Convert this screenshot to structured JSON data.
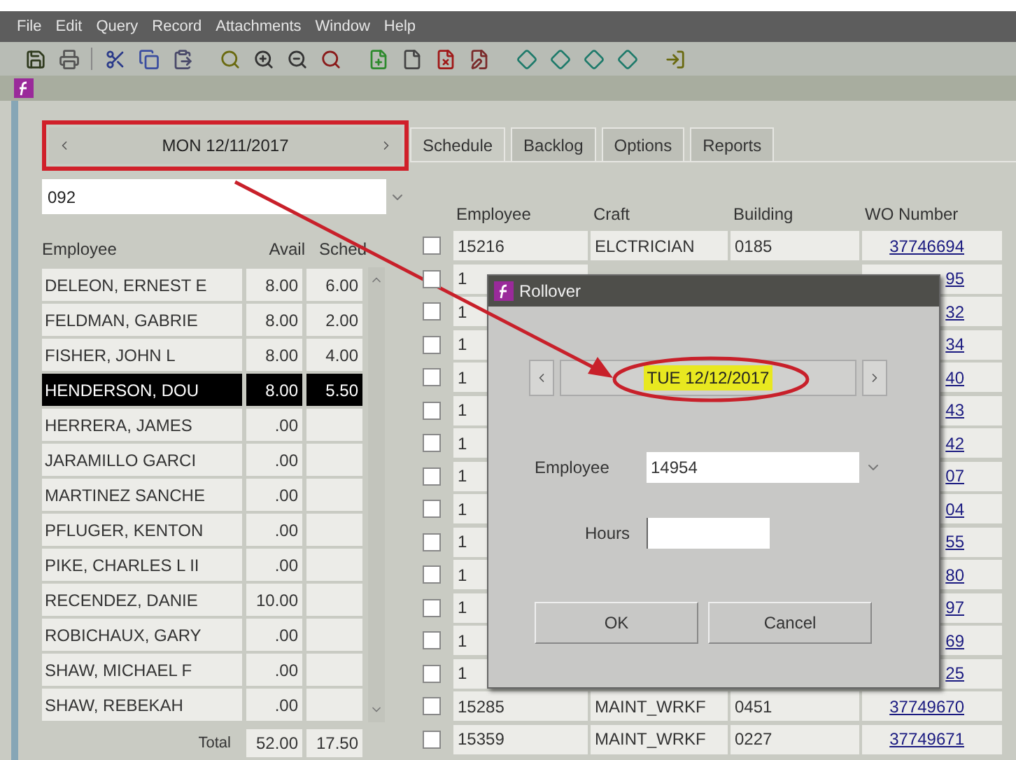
{
  "menu": [
    "File",
    "Edit",
    "Query",
    "Record",
    "Attachments",
    "Window",
    "Help"
  ],
  "date_nav": {
    "date": "MON 12/11/2017"
  },
  "crew_field": {
    "value": "092"
  },
  "employee_list": {
    "columns": [
      "Employee",
      "Avail",
      "Sched"
    ],
    "rows": [
      {
        "name": "DELEON, ERNEST E",
        "avail": "8.00",
        "sched": "6.00",
        "selected": false
      },
      {
        "name": "FELDMAN, GABRIE",
        "avail": "8.00",
        "sched": "2.00",
        "selected": false
      },
      {
        "name": "FISHER, JOHN L",
        "avail": "8.00",
        "sched": "4.00",
        "selected": false
      },
      {
        "name": "HENDERSON, DOU",
        "avail": "8.00",
        "sched": "5.50",
        "selected": true
      },
      {
        "name": "HERRERA, JAMES",
        "avail": ".00",
        "sched": "",
        "selected": false
      },
      {
        "name": "JARAMILLO GARCI",
        "avail": ".00",
        "sched": "",
        "selected": false
      },
      {
        "name": "MARTINEZ SANCHE",
        "avail": ".00",
        "sched": "",
        "selected": false
      },
      {
        "name": "PFLUGER, KENTON",
        "avail": ".00",
        "sched": "",
        "selected": false
      },
      {
        "name": "PIKE, CHARLES L II",
        "avail": ".00",
        "sched": "",
        "selected": false
      },
      {
        "name": "RECENDEZ, DANIE",
        "avail": "10.00",
        "sched": "",
        "selected": false
      },
      {
        "name": "ROBICHAUX, GARY",
        "avail": ".00",
        "sched": "",
        "selected": false
      },
      {
        "name": "SHAW, MICHAEL F",
        "avail": ".00",
        "sched": "",
        "selected": false
      },
      {
        "name": "SHAW, REBEKAH",
        "avail": ".00",
        "sched": "",
        "selected": false
      }
    ],
    "total": {
      "label": "Total",
      "avail": "52.00",
      "sched": "17.50"
    }
  },
  "tabs": [
    {
      "label": "Schedule",
      "selected": true
    },
    {
      "label": "Backlog",
      "selected": false
    },
    {
      "label": "Options",
      "selected": false
    },
    {
      "label": "Reports",
      "selected": false
    }
  ],
  "table": {
    "columns": [
      "Employee",
      "Craft",
      "Building",
      "WO Number"
    ],
    "rows": [
      {
        "checked": false,
        "employee": "15216",
        "craft": "ELCTRICIAN",
        "building": "0185",
        "wo_number": "37746694"
      },
      {
        "checked": false,
        "employee": "1",
        "craft": "",
        "building": "",
        "wo_number": "95"
      },
      {
        "checked": false,
        "employee": "1",
        "craft": "",
        "building": "",
        "wo_number": "32"
      },
      {
        "checked": false,
        "employee": "1",
        "craft": "",
        "building": "",
        "wo_number": "34"
      },
      {
        "checked": false,
        "employee": "1",
        "craft": "",
        "building": "",
        "wo_number": "40"
      },
      {
        "checked": false,
        "employee": "1",
        "craft": "",
        "building": "",
        "wo_number": "43"
      },
      {
        "checked": false,
        "employee": "1",
        "craft": "",
        "building": "",
        "wo_number": "42"
      },
      {
        "checked": false,
        "employee": "1",
        "craft": "",
        "building": "",
        "wo_number": "07"
      },
      {
        "checked": false,
        "employee": "1",
        "craft": "",
        "building": "",
        "wo_number": "04"
      },
      {
        "checked": false,
        "employee": "1",
        "craft": "",
        "building": "",
        "wo_number": "55"
      },
      {
        "checked": false,
        "employee": "1",
        "craft": "",
        "building": "",
        "wo_number": "80"
      },
      {
        "checked": false,
        "employee": "1",
        "craft": "",
        "building": "",
        "wo_number": "97"
      },
      {
        "checked": false,
        "employee": "1",
        "craft": "",
        "building": "",
        "wo_number": "69"
      },
      {
        "checked": false,
        "employee": "1",
        "craft": "",
        "building": "",
        "wo_number": "25"
      },
      {
        "checked": false,
        "employee": "15285",
        "craft": "MAINT_WRKF",
        "building": "0451",
        "wo_number": "37749670"
      },
      {
        "checked": false,
        "employee": "15359",
        "craft": "MAINT_WRKF",
        "building": "0227",
        "wo_number": "37749671"
      }
    ]
  },
  "dialog": {
    "title": "Rollover",
    "date": "TUE 12/12/2017",
    "employee_label": "Employee",
    "employee_value": "14954",
    "hours_label": "Hours",
    "buttons": [
      "OK",
      "Cancel"
    ]
  }
}
